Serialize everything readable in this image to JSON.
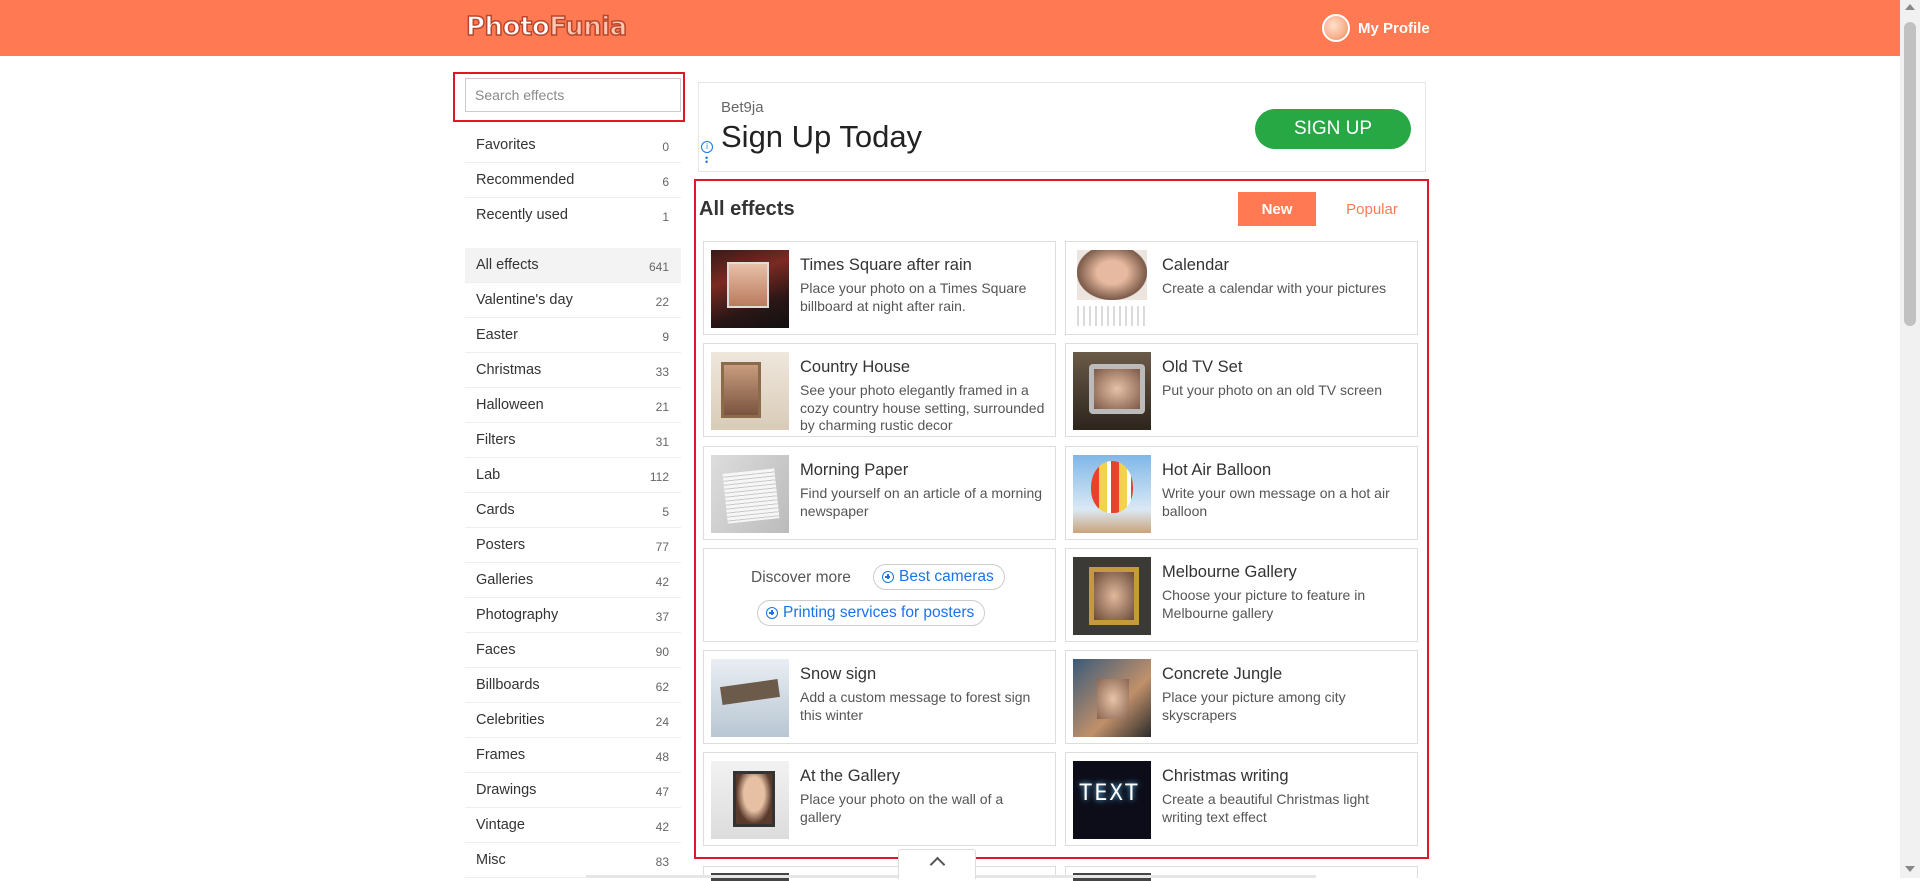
{
  "header": {
    "logo_part1": "Photo",
    "logo_part2": "Funia",
    "profile_label": "My Profile"
  },
  "search": {
    "placeholder": "Search effects",
    "value": ""
  },
  "sidebar": {
    "personal": [
      {
        "label": "Favorites",
        "count": "0"
      },
      {
        "label": "Recommended",
        "count": "6"
      },
      {
        "label": "Recently used",
        "count": "1"
      }
    ],
    "categories": [
      {
        "label": "All effects",
        "count": "641"
      },
      {
        "label": "Valentine's day",
        "count": "22"
      },
      {
        "label": "Easter",
        "count": "9"
      },
      {
        "label": "Christmas",
        "count": "33"
      },
      {
        "label": "Halloween",
        "count": "21"
      },
      {
        "label": "Filters",
        "count": "31"
      },
      {
        "label": "Lab",
        "count": "112"
      },
      {
        "label": "Cards",
        "count": "5"
      },
      {
        "label": "Posters",
        "count": "77"
      },
      {
        "label": "Galleries",
        "count": "42"
      },
      {
        "label": "Photography",
        "count": "37"
      },
      {
        "label": "Faces",
        "count": "90"
      },
      {
        "label": "Billboards",
        "count": "62"
      },
      {
        "label": "Celebrities",
        "count": "24"
      },
      {
        "label": "Frames",
        "count": "48"
      },
      {
        "label": "Drawings",
        "count": "47"
      },
      {
        "label": "Vintage",
        "count": "42"
      },
      {
        "label": "Misc",
        "count": "83"
      }
    ],
    "active": "All effects"
  },
  "ad": {
    "brand": "Bet9ja",
    "headline": "Sign Up Today",
    "cta": "SIGN UP",
    "info_glyph": "i"
  },
  "effects": {
    "title": "All effects",
    "tab_new": "New",
    "tab_popular": "Popular",
    "active_tab": "New",
    "cards": [
      {
        "title": "Times Square after rain",
        "desc": "Place your photo on a Times Square billboard at night after rain."
      },
      {
        "title": "Calendar",
        "desc": "Create a calendar with your pictures"
      },
      {
        "title": "Country House",
        "desc": "See your photo elegantly framed in a cozy country house setting, surrounded by charming rustic decor"
      },
      {
        "title": "Old TV Set",
        "desc": "Put your photo on an old TV screen"
      },
      {
        "title": "Morning Paper",
        "desc": "Find yourself on an article of a morning newspaper"
      },
      {
        "title": "Hot Air Balloon",
        "desc": "Write your own message on a hot air balloon"
      },
      {
        "title": "Melbourne Gallery",
        "desc": "Choose your picture to feature in Melbourne gallery"
      },
      {
        "title": "Snow sign",
        "desc": "Add a custom message to forest sign this winter"
      },
      {
        "title": "Concrete Jungle",
        "desc": "Place your picture among city skyscrapers"
      },
      {
        "title": "At the Gallery",
        "desc": "Place your photo on the wall of a gallery"
      },
      {
        "title": "Christmas writing",
        "desc": "Create a beautiful Christmas light writing text effect"
      }
    ],
    "discover": {
      "label": "Discover more",
      "links": [
        "Best cameras",
        "Printing services for posters"
      ]
    }
  },
  "colors": {
    "brand": "#ff7a52",
    "highlight_outline": "#e0162b",
    "ad_button": "#28a745",
    "link": "#1a73e8"
  },
  "icons": {
    "avatar": "avatar-icon",
    "scroll_up": "chevron-up-icon",
    "info": "info-icon",
    "more": "more-vertical-icon",
    "plus": "plus-circle-icon"
  }
}
